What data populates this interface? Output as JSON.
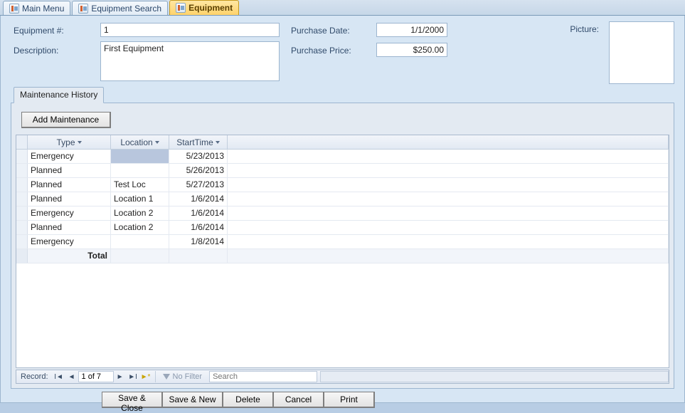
{
  "tabs": [
    {
      "label": "Main Menu",
      "active": false
    },
    {
      "label": "Equipment Search",
      "active": false
    },
    {
      "label": "Equipment",
      "active": true
    }
  ],
  "form": {
    "equipNumLabel": "Equipment #:",
    "equipNum": "1",
    "descLabel": "Description:",
    "desc": "First Equipment",
    "purchaseDateLabel": "Purchase Date:",
    "purchaseDate": "1/1/2000",
    "purchasePriceLabel": "Purchase Price:",
    "purchasePrice": "$250.00",
    "pictureLabel": "Picture:"
  },
  "subForm": {
    "tabLabel": "Maintenance History",
    "addBtn": "Add Maintenance",
    "columns": {
      "type": "Type",
      "location": "Location",
      "startTime": "StartTime"
    },
    "rows": [
      {
        "type": "Emergency",
        "location": "",
        "start": "5/23/2013",
        "sel": true
      },
      {
        "type": "Planned",
        "location": "",
        "start": "5/26/2013",
        "sel": false
      },
      {
        "type": "Planned",
        "location": "Test Loc",
        "start": "5/27/2013",
        "sel": false
      },
      {
        "type": "Planned",
        "location": "Location 1",
        "start": "1/6/2014",
        "sel": false
      },
      {
        "type": "Emergency",
        "location": "Location 2",
        "start": "1/6/2014",
        "sel": false
      },
      {
        "type": "Planned",
        "location": "Location 2",
        "start": "1/6/2014",
        "sel": false
      },
      {
        "type": "Emergency",
        "location": "",
        "start": "1/8/2014",
        "sel": false
      }
    ],
    "totalLabel": "Total",
    "nav": {
      "recordLabel": "Record:",
      "position": "1 of 7",
      "noFilter": "No Filter",
      "searchPlaceholder": "Search"
    }
  },
  "actions": {
    "saveClose": "Save & Close",
    "saveNew": "Save & New",
    "delete": "Delete",
    "cancel": "Cancel",
    "print": "Print"
  }
}
